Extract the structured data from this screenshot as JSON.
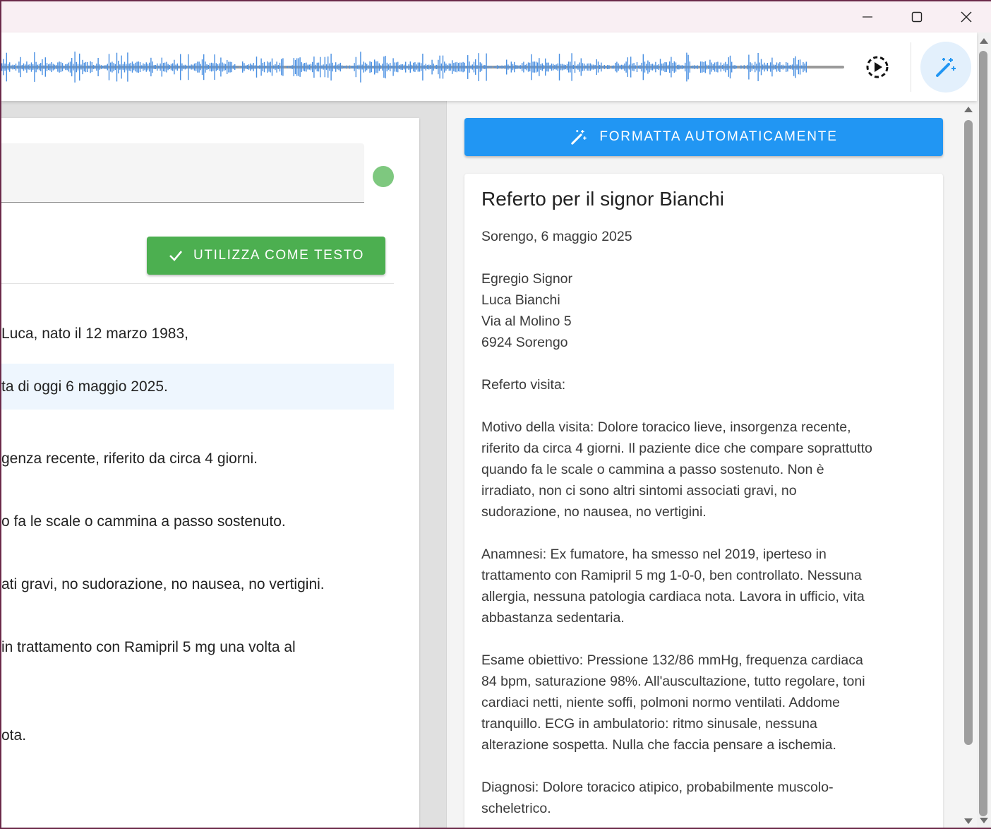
{
  "window": {
    "controls": [
      "minimize",
      "maximize",
      "close"
    ]
  },
  "toolbar": {
    "play_icon": "play-circle-dashed-icon",
    "magic_icon": "magic-wand-icon"
  },
  "transcript": {
    "use_button_label": "UTILIZZA COME TESTO",
    "lines": [
      "Luca, nato il 12 marzo 1983,",
      "ta di oggi 6 maggio 2025.",
      "genza recente, riferito da circa 4 giorni.",
      "o fa le scale o cammina a passo sostenuto.",
      "ati gravi, no sudorazione, no nausea, no vertigini.",
      " in trattamento con Ramipril 5 mg una volta al",
      "",
      "ota."
    ]
  },
  "report": {
    "format_button_label": "FORMATTA AUTOMATICAMENTE",
    "title": "Referto per il signor Bianchi",
    "lines": [
      "Sorengo, 6 maggio 2025",
      "",
      "Egregio Signor",
      "Luca Bianchi",
      "Via al Molino 5",
      "6924 Sorengo",
      "",
      "Referto visita:",
      "",
      "Motivo della visita: Dolore toracico lieve, insorgenza recente,",
      "riferito da circa 4 giorni. Il paziente dice che compare soprattutto",
      "quando fa le scale o cammina a passo sostenuto. Non è",
      "irradiato, non ci sono altri sintomi associati gravi, no",
      "sudorazione, no nausea, no vertigini.",
      "",
      "Anamnesi: Ex fumatore, ha smesso nel 2019, iperteso in",
      "trattamento con Ramipril 5 mg 1-0-0, ben controllato. Nessuna",
      "allergia, nessuna patologia cardiaca nota. Lavora in ufficio, vita",
      "abbastanza sedentaria.",
      "",
      "Esame obiettivo: Pressione 132/86 mmHg, frequenza cardiaca",
      "84 bpm, saturazione 98%. All'auscultazione, tutto regolare, toni",
      "cardiaci netti, niente soffi, polmoni normo ventilati. Addome",
      "tranquillo. ECG in ambulatorio: ritmo sinusale, nessuna",
      "alterazione sospetta. Nulla che faccia pensare a ischemia.",
      "",
      "Diagnosi: Dolore toracico atipico, probabilmente muscolo-",
      "scheletrico."
    ]
  },
  "colors": {
    "accent_blue": "#2196f3",
    "accent_green": "#4caf50",
    "waveform_blue": "#4a90e2",
    "status_dot": "#7ec87f"
  }
}
